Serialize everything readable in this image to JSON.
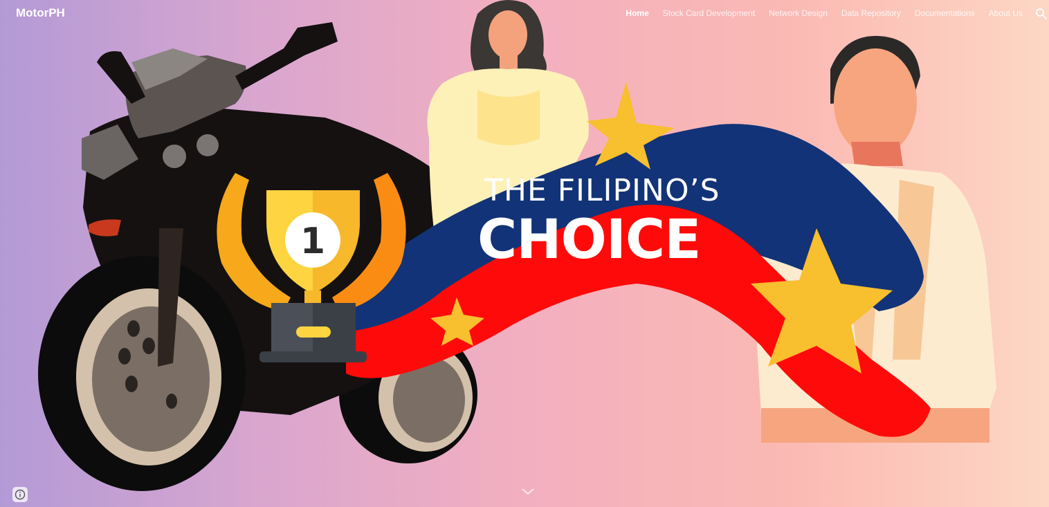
{
  "brand": {
    "name": "MotorPH"
  },
  "nav": {
    "items": [
      {
        "label": "Home",
        "active": true
      },
      {
        "label": "Stock Card Development",
        "active": false
      },
      {
        "label": "Network Design",
        "active": false
      },
      {
        "label": "Data Repository",
        "active": false
      },
      {
        "label": "Documentations",
        "active": false
      },
      {
        "label": "About Us",
        "active": false
      }
    ],
    "search_icon": "search-icon"
  },
  "hero": {
    "line1": "THE FILIPINO’S",
    "line2": "CHOICE",
    "trophy_number": "1"
  },
  "footer": {
    "info_icon": "info-icon",
    "scroll_icon": "chevron-down-icon"
  },
  "colors": {
    "flag_blue": "#123377",
    "flag_red": "#ff0a0a",
    "star_yellow": "#f8bf2e",
    "gradient_left": "#b39ad6",
    "gradient_right": "#fdd7c4"
  }
}
